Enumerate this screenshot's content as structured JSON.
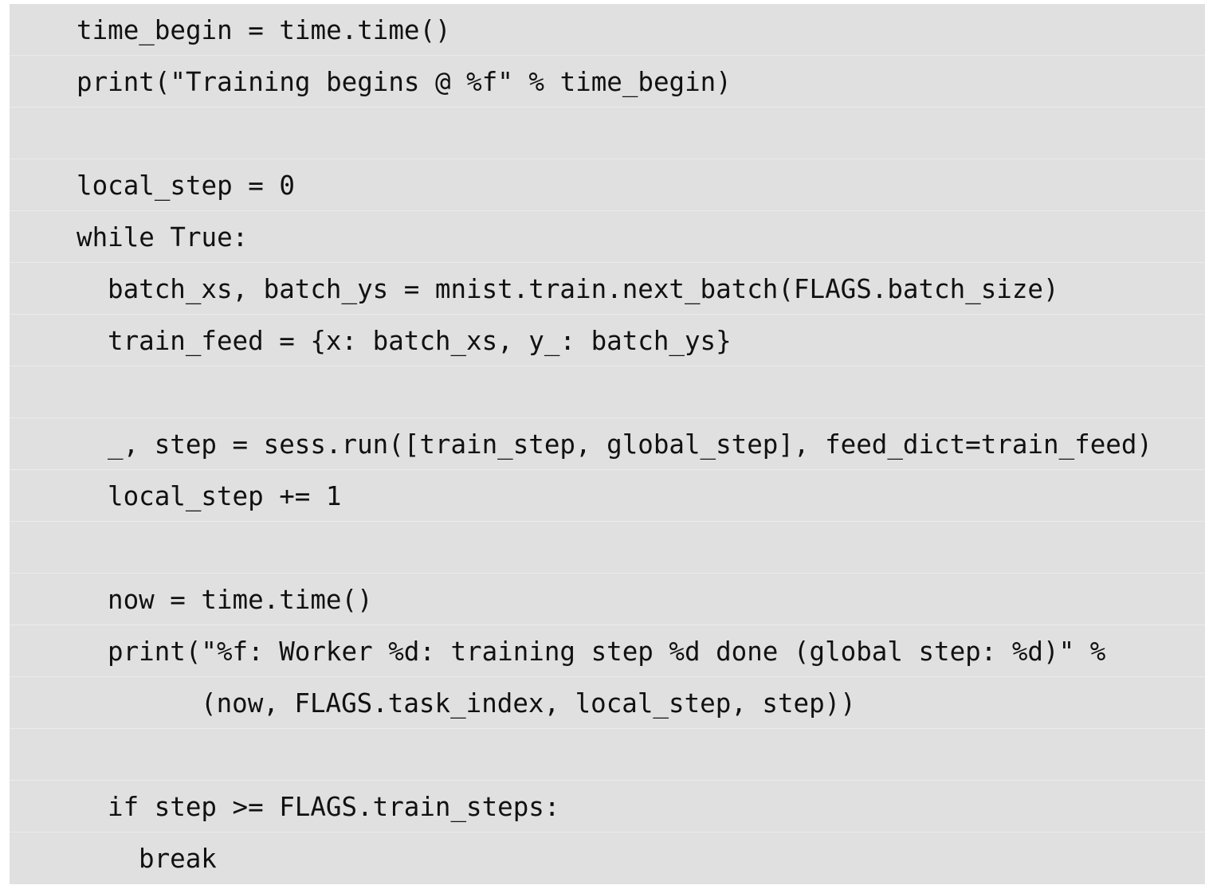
{
  "code": {
    "lines": [
      {
        "text": "time_begin = time.time()",
        "indent": 0
      },
      {
        "text": "print(\"Training begins @ %f\" % time_begin)",
        "indent": 0
      },
      {
        "text": "",
        "indent": 0
      },
      {
        "text": "local_step = 0",
        "indent": 0
      },
      {
        "text": "while True:",
        "indent": 0
      },
      {
        "text": "batch_xs, batch_ys = mnist.train.next_batch(FLAGS.batch_size)",
        "indent": 1
      },
      {
        "text": "train_feed = {x: batch_xs, y_: batch_ys}",
        "indent": 1
      },
      {
        "text": "",
        "indent": 0
      },
      {
        "text": "_, step = sess.run([train_step, global_step], feed_dict=train_feed)",
        "indent": 1
      },
      {
        "text": "local_step += 1",
        "indent": 1
      },
      {
        "text": "",
        "indent": 0
      },
      {
        "text": "now = time.time()",
        "indent": 1
      },
      {
        "text": "print(\"%f: Worker %d: training step %d done (global step: %d)\" %",
        "indent": 1
      },
      {
        "text": "(now, FLAGS.task_index, local_step, step))",
        "indent": 4
      },
      {
        "text": "",
        "indent": 0
      },
      {
        "text": "if step >= FLAGS.train_steps:",
        "indent": 1
      },
      {
        "text": "break",
        "indent": 2
      }
    ]
  }
}
